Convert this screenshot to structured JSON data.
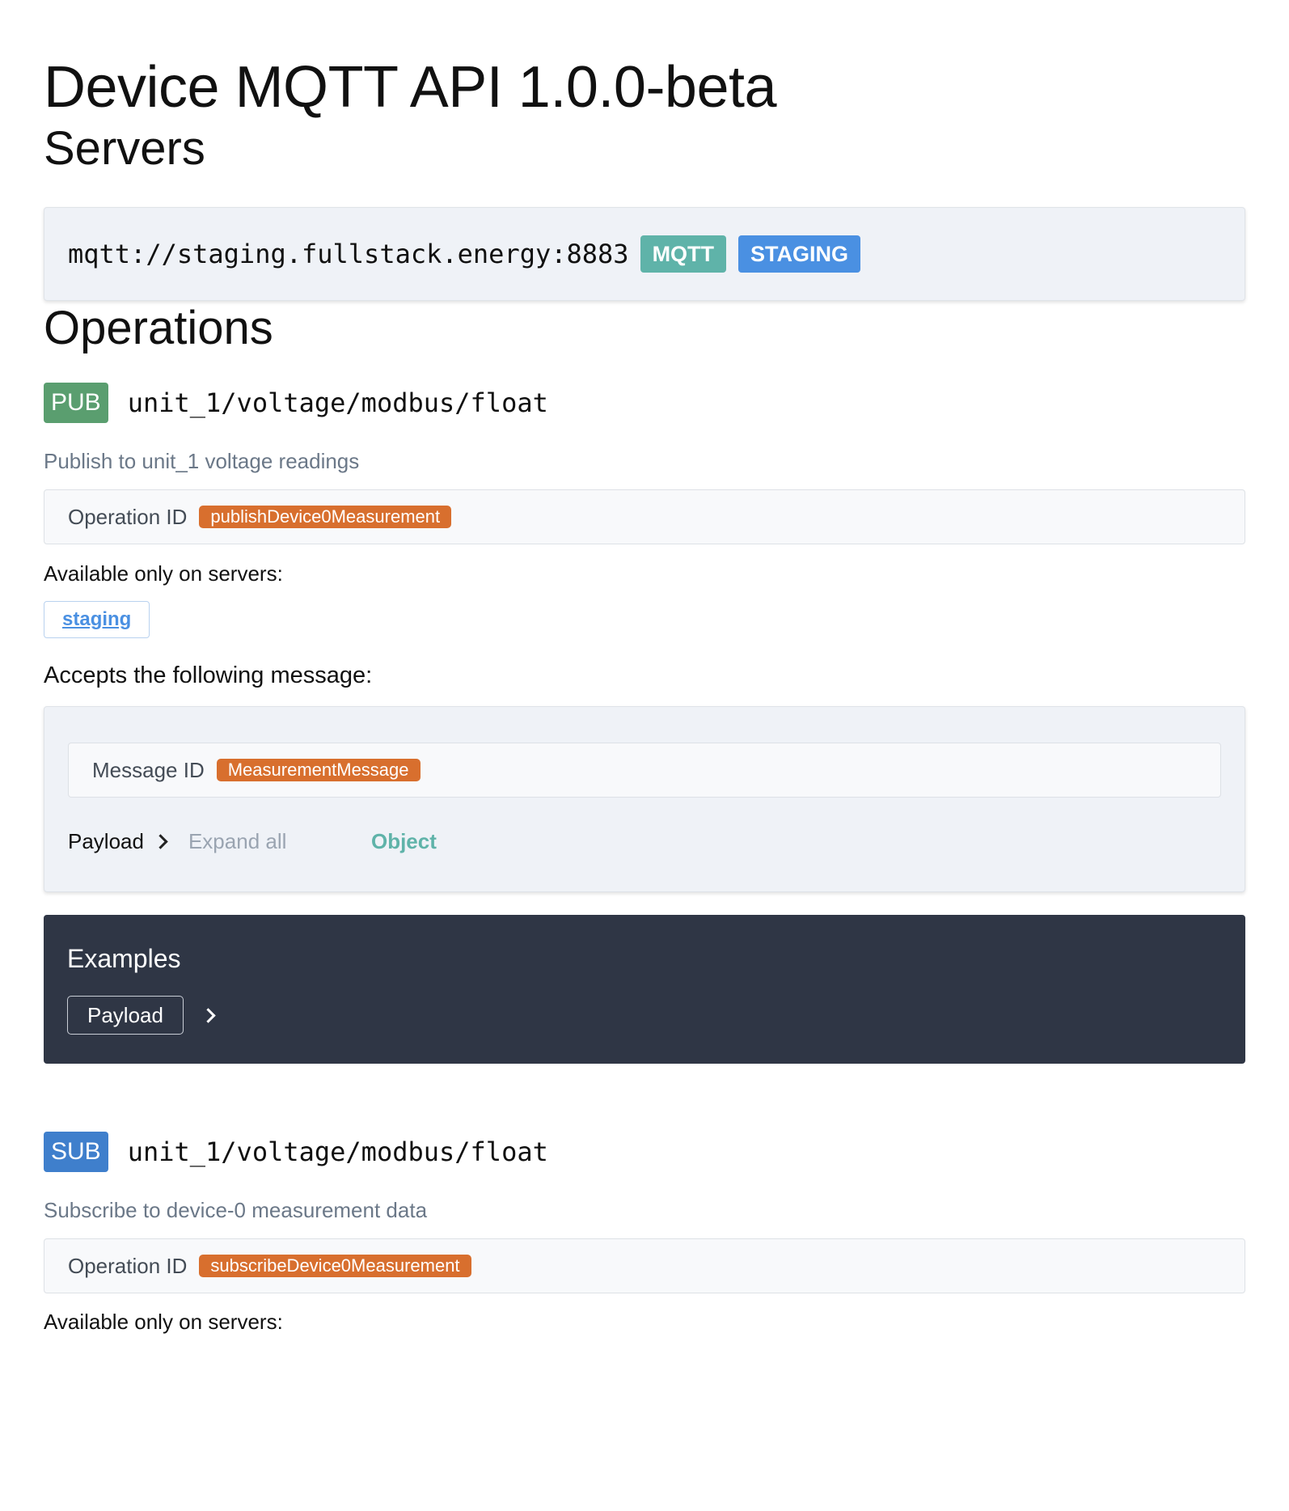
{
  "page": {
    "title": "Device MQTT API 1.0.0-beta"
  },
  "servers": {
    "heading": "Servers",
    "items": [
      {
        "url": "mqtt://staging.fullstack.energy:8883",
        "protocol_tag": "MQTT",
        "env_tag": "STAGING"
      }
    ]
  },
  "operations": {
    "heading": "Operations",
    "items": [
      {
        "method": "PUB",
        "channel": "unit_1/voltage/modbus/float",
        "description": "Publish to unit_1 voltage readings",
        "operation_id_label": "Operation ID",
        "operation_id": "publishDevice0Measurement",
        "available_label": "Available only on servers:",
        "servers": [
          "staging"
        ],
        "accepts_label": "Accepts the following message:",
        "message": {
          "id_label": "Message ID",
          "id": "MeasurementMessage",
          "payload_label": "Payload",
          "expand_all_label": "Expand all",
          "payload_type": "Object"
        },
        "examples": {
          "title": "Examples",
          "payload_button": "Payload"
        }
      },
      {
        "method": "SUB",
        "channel": "unit_1/voltage/modbus/float",
        "description": "Subscribe to device-0 measurement data",
        "operation_id_label": "Operation ID",
        "operation_id": "subscribeDevice0Measurement",
        "available_label": "Available only on servers:"
      }
    ]
  },
  "colors": {
    "pub": "#5a9e6f",
    "sub": "#3f7fcc",
    "id_pill": "#d86f2e",
    "mqtt_tag": "#5fb3a9",
    "staging_tag": "#4a90e2",
    "examples_bg": "#2f3645"
  }
}
